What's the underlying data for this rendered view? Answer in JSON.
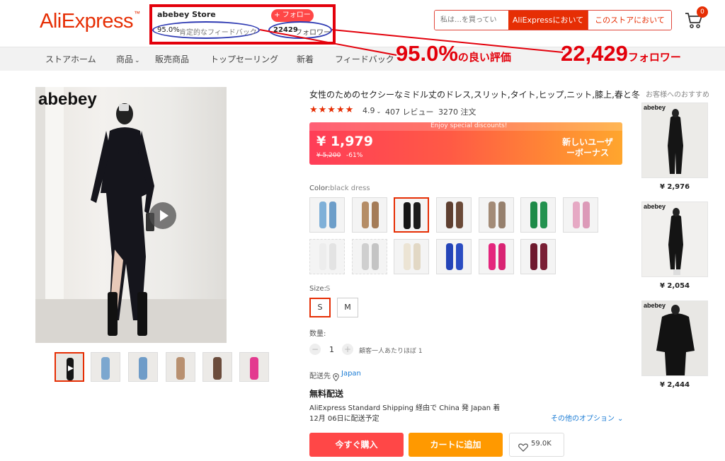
{
  "header": {
    "logo": "AliExpress",
    "logo_tm": "™",
    "store_name": "abebey Store",
    "follow_label": "+ フォロー",
    "feedback_pct": "95.0%",
    "feedback_label": "肯定的なフィードバック",
    "followers_num": "22429",
    "followers_label": "フォロワー",
    "search_placeholder": "私は…を買ってい",
    "search_ae_label": "AliExpressにおいて",
    "search_store_label": "このストアにおいて",
    "cart_count": "0"
  },
  "nav": {
    "items": [
      "ストアホーム",
      "商品",
      "販売商品",
      "トップセーリング",
      "新着",
      "フィードバック"
    ]
  },
  "annotations": {
    "feedback_big": "95.0%",
    "feedback_small": "の良い評価",
    "followers_big": "22,429",
    "followers_small": "フォロワー"
  },
  "product": {
    "brand_overlay": "abebey",
    "title": "女性のためのセクシーなミドル丈のドレス,スリット,タイト,ヒップ,ニット,膝上,春と冬",
    "stars": "★★★★★",
    "rating": "4.9",
    "rating_value": 4.9,
    "reviews": "407 レビュー",
    "orders": "3270 注文",
    "enjoy": "Enjoy special discounts!",
    "price": "¥ 1,979",
    "old_price": "¥ 5,200",
    "discount": "-61%",
    "new_user_line1": "新しいユーザ",
    "new_user_line2": "ーボーナス",
    "color_label": "Color:",
    "color_value": "black dress",
    "size_label": "Size:",
    "size_value": "S",
    "sizes": [
      "S",
      "M"
    ],
    "qty_label": "数量:",
    "qty_minus": "−",
    "qty_value": "1",
    "qty_plus": "+",
    "qty_limit": "顧客一人あたりほぼ 1",
    "ship_label": "配送先",
    "ship_to": "Japan",
    "free_ship": "無料配送",
    "ship_method": "AliExpress Standard Shipping 経由で China 発 Japan 着",
    "ship_date": "12月 06日に配送予定",
    "other_opts": "その他のオプション",
    "buy_label": "今すぐ購入",
    "cart_label": "カートに追加",
    "wish_count": "59.0K"
  },
  "recommendations": {
    "title": "お客様へのおすすめ",
    "items": [
      {
        "brand": "abebey",
        "price": "¥ 2,976"
      },
      {
        "brand": "abebey",
        "price": "¥ 2,054"
      },
      {
        "brand": "abebey",
        "price": "¥ 2,444"
      }
    ]
  },
  "colors": {
    "accent": "#e62e04",
    "annotation_red": "#e3000b",
    "oval_blue": "#2f3bb3",
    "link_blue": "#1a7bd4"
  }
}
